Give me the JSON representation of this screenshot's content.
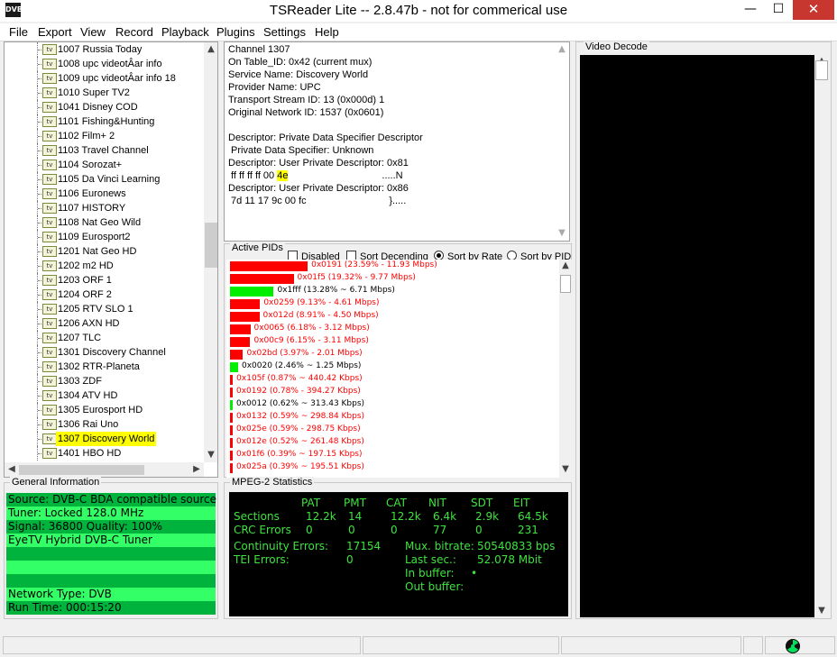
{
  "window": {
    "title": "TSReader Lite -- 2.8.47b - not for commerical use",
    "icon_text": "DVB",
    "minimize_glyph": "—",
    "maximize_glyph": "☐",
    "close_glyph": "✕"
  },
  "menu": [
    "File",
    "Export",
    "View",
    "Record",
    "Playback",
    "Plugins",
    "Settings",
    "Help"
  ],
  "channels": [
    {
      "label": "1007 Russia Today"
    },
    {
      "label": "1008 upc videotÂar info"
    },
    {
      "label": "1009 upc videotÂar info 18"
    },
    {
      "label": "1010 Super TV2"
    },
    {
      "label": "1041 Disney COD"
    },
    {
      "label": "1101 Fishing&Hunting"
    },
    {
      "label": "1102 Film+ 2"
    },
    {
      "label": "1103 Travel Channel"
    },
    {
      "label": "1104 Sorozat+"
    },
    {
      "label": "1105 Da Vinci Learning"
    },
    {
      "label": "1106 Euronews"
    },
    {
      "label": "1107 HISTORY"
    },
    {
      "label": "1108 Nat Geo Wild"
    },
    {
      "label": "1109 Eurosport2"
    },
    {
      "label": "1201 Nat Geo HD"
    },
    {
      "label": "1202 m2 HD"
    },
    {
      "label": "1203 ORF 1"
    },
    {
      "label": "1204 ORF 2"
    },
    {
      "label": "1205 RTV SLO 1"
    },
    {
      "label": "1206 AXN HD"
    },
    {
      "label": "1207 TLC"
    },
    {
      "label": "1301 Discovery Channel"
    },
    {
      "label": "1302 RTR-Planeta"
    },
    {
      "label": "1303 ZDF"
    },
    {
      "label": "1304 ATV HD"
    },
    {
      "label": "1305 Eurosport HD"
    },
    {
      "label": "1306 Rai Uno"
    },
    {
      "label": "1307 Discovery World",
      "selected": true
    },
    {
      "label": "1401 HBO HD"
    }
  ],
  "channel_icon_text": "tv",
  "descriptor": {
    "lines": [
      "Channel 1307",
      "On Table_ID: 0x42 (current mux)",
      "Service Name: Discovery World",
      "Provider Name: UPC",
      "Transport Stream ID: 13 (0x000d) 1",
      "Original Network ID: 1537 (0x0601)",
      "",
      "Descriptor: Private Data Specifier Descriptor",
      " Private Data Specifier: Unknown",
      "Descriptor: User Private Descriptor: 0x81",
      "HEXLINE",
      "Descriptor: User Private Descriptor: 0x86",
      " 7d 11 17 9c 00 fc                              }....."
    ],
    "hex_prefix": " ff ff ff ff 00 ",
    "hex_highlight": "4e",
    "hex_suffix": "                                  .....N"
  },
  "active_pids": {
    "legend": "Active PIDs",
    "disabled_label": "Disabled",
    "sort_desc_label": "Sort Decending",
    "sort_rate_label": "Sort by Rate",
    "sort_pid_label": "Sort by PID",
    "sort_selected": "rate",
    "colors": {
      "red": "#ff0000",
      "green": "#00ee00"
    },
    "rows": [
      {
        "text": "0x0191 (23.59% - 11.93 Mbps)",
        "pct": 23.59,
        "color": "red"
      },
      {
        "text": "0x01f5 (19.32% - 9.77 Mbps)",
        "pct": 19.32,
        "color": "red"
      },
      {
        "text": "0x1fff (13.28% ~ 6.71 Mbps)",
        "pct": 13.28,
        "color": "green"
      },
      {
        "text": "0x0259 (9.13% - 4.61 Mbps)",
        "pct": 9.13,
        "color": "red"
      },
      {
        "text": "0x012d (8.91% - 4.50 Mbps)",
        "pct": 8.91,
        "color": "red"
      },
      {
        "text": "0x0065 (6.18% - 3.12 Mbps)",
        "pct": 6.18,
        "color": "red"
      },
      {
        "text": "0x00c9 (6.15% - 3.11 Mbps)",
        "pct": 6.15,
        "color": "red"
      },
      {
        "text": "0x02bd (3.97% - 2.01 Mbps)",
        "pct": 3.97,
        "color": "red"
      },
      {
        "text": "0x0020 (2.46% ~ 1.25 Mbps)",
        "pct": 2.46,
        "color": "green"
      },
      {
        "text": "0x105f (0.87% ~ 440.42 Kbps)",
        "pct": 0.87,
        "color": "red"
      },
      {
        "text": "0x0192 (0.78% - 394.27 Kbps)",
        "pct": 0.78,
        "color": "red"
      },
      {
        "text": "0x0012 (0.62% ~ 313.43 Kbps)",
        "pct": 0.62,
        "color": "green"
      },
      {
        "text": "0x0132 (0.59% ~ 298.84 Kbps)",
        "pct": 0.59,
        "color": "red"
      },
      {
        "text": "0x025e (0.59% - 298.75 Kbps)",
        "pct": 0.59,
        "color": "red"
      },
      {
        "text": "0x012e (0.52% ~ 261.48 Kbps)",
        "pct": 0.52,
        "color": "red"
      },
      {
        "text": "0x01f6 (0.39% ~ 197.15 Kbps)",
        "pct": 0.39,
        "color": "red"
      },
      {
        "text": "0x025a (0.39% ~ 195.51 Kbps)",
        "pct": 0.39,
        "color": "red"
      }
    ]
  },
  "general_info": {
    "legend": "General Information",
    "colors": {
      "bright": "#33ff66",
      "dark": "#00b33c"
    },
    "rows": [
      {
        "text": "Source: DVB-C BDA compatible source",
        "shade": "dark"
      },
      {
        "text": "Tuner: Locked 128.0 MHz",
        "shade": "bright"
      },
      {
        "text": "Signal: 36800 Quality: 100%",
        "shade": "dark"
      },
      {
        "text": "EyeTV Hybrid DVB-C Tuner",
        "shade": "bright"
      },
      {
        "text": "",
        "shade": "dark"
      },
      {
        "text": "",
        "shade": "bright"
      },
      {
        "text": "",
        "shade": "dark"
      },
      {
        "text": "Network Type: DVB",
        "shade": "bright"
      },
      {
        "text": "Run Time: 000:15:20",
        "shade": "dark"
      }
    ]
  },
  "mpeg2_stats": {
    "legend": "MPEG-2 Statistics",
    "headers": [
      "PAT",
      "PMT",
      "CAT",
      "NIT",
      "SDT",
      "EIT"
    ],
    "sections_label": "Sections",
    "sections": [
      "12.2k",
      "14",
      "12.2k",
      "6.4k",
      "2.9k",
      "64.5k"
    ],
    "crc_label": "CRC Errors",
    "crc": [
      "0",
      "0",
      "0",
      "77",
      "0",
      "231"
    ],
    "continuity_label": "Continuity Errors:",
    "continuity_value": "17154",
    "tei_label": "TEI Errors:",
    "tei_value": "0",
    "mux_label": "Mux. bitrate:",
    "mux_value": "50540833 bps",
    "last_sec_label": "Last sec.:",
    "last_sec_value": "52.078 Mbit",
    "in_buffer_label": "In buffer:",
    "in_buffer_value": "•",
    "out_buffer_label": "Out buffer:"
  },
  "video": {
    "legend": "Video Decode"
  }
}
